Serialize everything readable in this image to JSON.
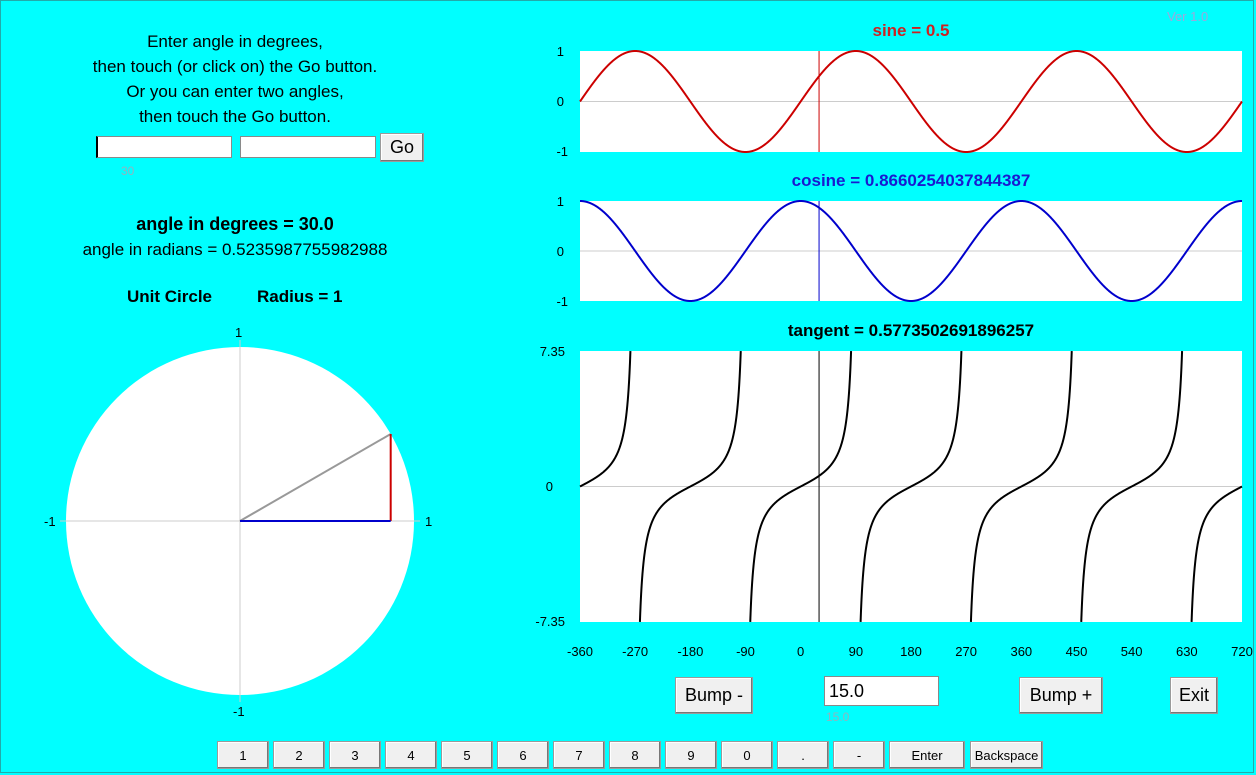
{
  "version": "Ver 1.0",
  "instructions": [
    "Enter angle in degrees,",
    "then touch (or click on) the Go button.",
    "Or you can enter two angles,",
    "then touch the Go button."
  ],
  "inputs": {
    "angle1_value": "",
    "angle1_hint": "30",
    "angle2_value": "",
    "go_label": "Go"
  },
  "angle_info": {
    "degrees": "angle in degrees = 30.0",
    "radians": "angle in radians = 0.5235987755982988"
  },
  "unit_circle": {
    "title": "Unit Circle",
    "radius_label": "Radius = 1",
    "top": "1",
    "bottom": "-1",
    "left": "-1",
    "right": "1",
    "angle_deg": 30
  },
  "chart_data": [
    {
      "type": "line",
      "title": "sine = 0.5",
      "function": "sin",
      "xlim": [
        -360,
        720
      ],
      "ylim": [
        -1,
        1
      ],
      "yticks": [
        "1",
        "0",
        "-1"
      ],
      "marker_x": 30,
      "color": "#cc0000"
    },
    {
      "type": "line",
      "title": "cosine = 0.8660254037844387",
      "function": "cos",
      "xlim": [
        -360,
        720
      ],
      "ylim": [
        -1,
        1
      ],
      "yticks": [
        "1",
        "0",
        "-1"
      ],
      "marker_x": 30,
      "color": "#0000cc"
    },
    {
      "type": "line",
      "title": "tangent = 0.5773502691896257",
      "function": "tan",
      "xlim": [
        -360,
        720
      ],
      "ylim": [
        -7.35,
        7.35
      ],
      "yticks": [
        "7.35",
        "0",
        "-7.35"
      ],
      "marker_x": 30,
      "color": "#000000",
      "xticks": [
        "-360",
        "-270",
        "-180",
        "-90",
        "0",
        "90",
        "180",
        "270",
        "360",
        "450",
        "540",
        "630",
        "720"
      ]
    }
  ],
  "controls": {
    "bump_minus": "Bump -",
    "bump_value": "15.0",
    "bump_hint": "15.0",
    "bump_plus": "Bump +",
    "exit": "Exit"
  },
  "keypad": [
    "1",
    "2",
    "3",
    "4",
    "5",
    "6",
    "7",
    "8",
    "9",
    "0",
    ".",
    "-",
    "Enter",
    "Backspace"
  ]
}
